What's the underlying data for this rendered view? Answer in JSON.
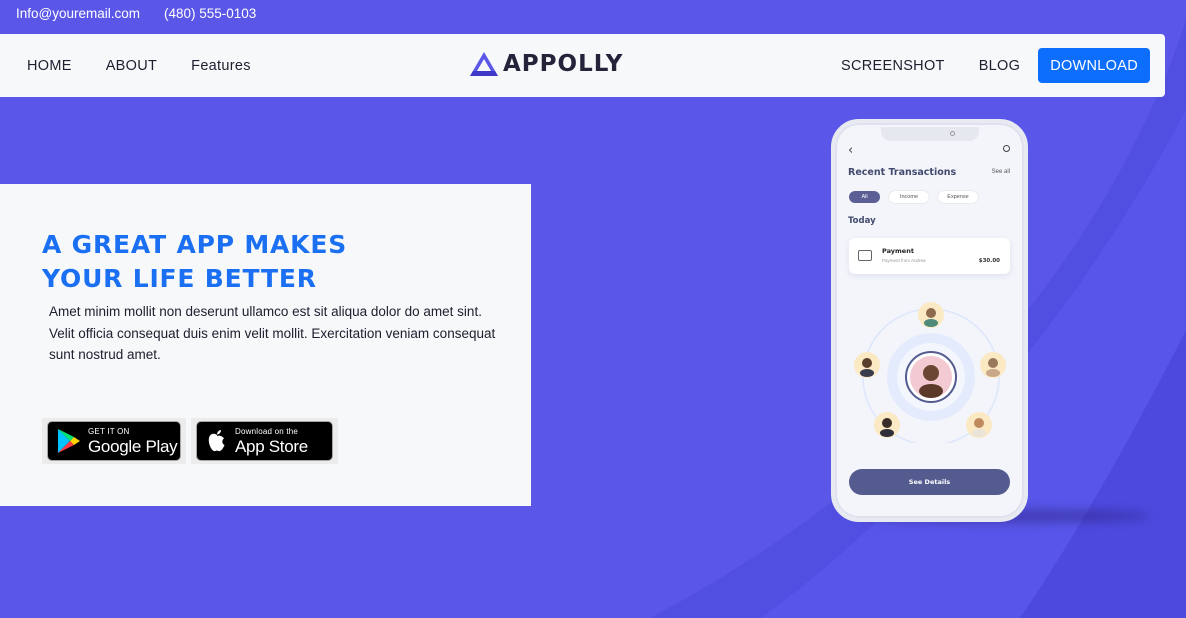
{
  "topbar": {
    "email": "Info@youremail.com",
    "phone": "(480) 555-0103"
  },
  "nav": {
    "left": [
      {
        "label": "HOME"
      },
      {
        "label": "ABOUT"
      },
      {
        "label": "Features"
      }
    ],
    "logo_text": "APPOLLY",
    "right": [
      {
        "label": "SCREENSHOT"
      },
      {
        "label": "BLOG"
      }
    ],
    "download_label": "DOWNLOAD"
  },
  "hero": {
    "title_line1": "A GREAT APP MAKES",
    "title_line2": "YOUR LIFE BETTER",
    "description": "Amet minim mollit non deserunt ullamco est sit aliqua dolor do amet sint. Velit officia consequat duis enim velit mollit. Exercitation veniam consequat sunt nostrud amet.",
    "google_play": {
      "small": "GET IT ON",
      "big": "Google Play"
    },
    "app_store": {
      "small": "Download on the",
      "big": "App Store"
    }
  },
  "phone": {
    "title": "Recent Transactions",
    "see_all": "See all",
    "chips": [
      "All",
      "Income",
      "Expense"
    ],
    "section": "Today",
    "transaction": {
      "title": "Payment",
      "subtitle": "Payment from Andrea",
      "amount": "$30.00"
    },
    "button_label": "See Details"
  },
  "colors": {
    "background": "#5a57e8",
    "accent_blue": "#0d6efd",
    "title_blue": "#1a6ff2",
    "card_bg": "#f6f8fa"
  },
  "icons": {
    "logo": "triangle-logo-icon",
    "google_play": "google-play-icon",
    "apple": "apple-icon"
  }
}
